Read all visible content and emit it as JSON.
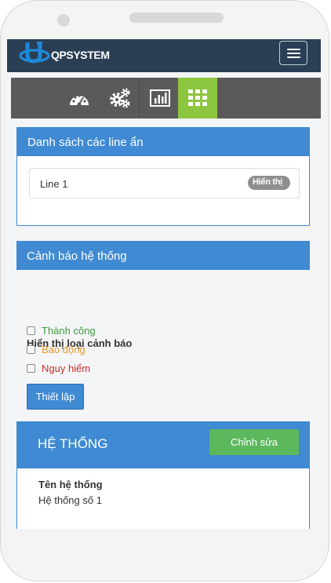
{
  "app": {
    "brand": "QPSYSTEM"
  },
  "toolbar": {
    "items": [
      {
        "icon": "dashboard-icon",
        "active": false
      },
      {
        "icon": "gears-icon",
        "active": false
      },
      {
        "icon": "bar-chart-icon",
        "active": false
      },
      {
        "icon": "grid-icon",
        "active": true
      }
    ]
  },
  "hidden_lines": {
    "title": "Danh sách các line ẩn",
    "items": [
      {
        "name": "Line 1",
        "badge": "Hiển thị"
      }
    ]
  },
  "alerts": {
    "title": "Cảnh báo hệ thống",
    "settings_title": "Hiển thị loại cảnh báo",
    "options": [
      {
        "label": "Thành công",
        "color": "#3c9a3c",
        "checked": false
      },
      {
        "label": "Báo động",
        "color": "#e39a2b",
        "checked": false
      },
      {
        "label": "Nguy hiểm",
        "color": "#c9302c",
        "checked": false
      }
    ],
    "setup_button": "Thiết lập"
  },
  "system": {
    "title": "HỆ THỐNG",
    "edit_button": "Chỉnh sửa",
    "fields": [
      {
        "label": "Tên hệ thống",
        "value": "Hệ thống số 1"
      }
    ]
  },
  "colors": {
    "navbar": "#2a3f55",
    "primary": "#3f8ad2",
    "active": "#8dc63f",
    "success": "#5cb85c"
  }
}
